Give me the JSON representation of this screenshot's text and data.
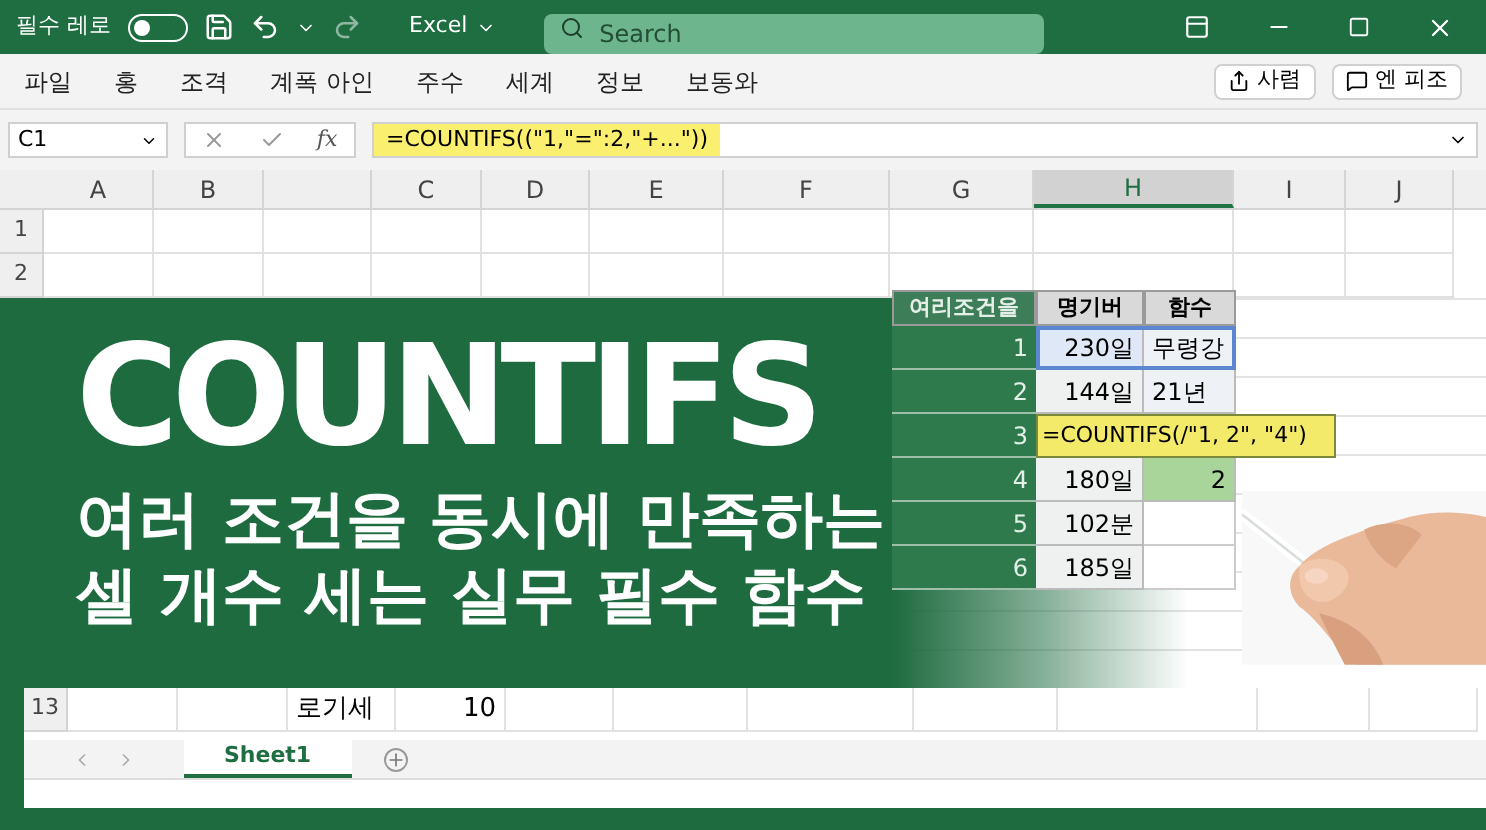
{
  "title_bar": {
    "autosave_label": "필수 레로",
    "autosave_on": false,
    "app_name": "Excel",
    "search": {
      "placeholder": "Search"
    }
  },
  "ribbon": {
    "tabs": [
      "파일",
      "홍",
      "조격",
      "계폭 아인",
      "주수",
      "세계",
      "정보",
      "보동와"
    ],
    "buttons": [
      {
        "kind": "share",
        "label": "사렴"
      },
      {
        "kind": "comment",
        "label": "엔 피조"
      }
    ]
  },
  "formula_bar": {
    "name_box": "C1",
    "function_label": "fx",
    "formula": "=COUNTIFS((\"1,\"=\":2,\"+...\"))"
  },
  "columns": [
    {
      "label": "A",
      "selected": false
    },
    {
      "label": "B",
      "selected": false
    },
    {
      "selected": false
    },
    {
      "label": "C",
      "selected": false
    },
    {
      "label": "D",
      "selected": false
    },
    {
      "label": "E",
      "selected": false
    },
    {
      "label": "F",
      "selected": false
    },
    {
      "label": "G",
      "selected": false
    },
    {
      "label": "H",
      "selected": true
    },
    {
      "label": "I",
      "selected": false
    },
    {
      "label": "J",
      "selected": false
    }
  ],
  "top_rows": [
    "1",
    "2"
  ],
  "banner": {
    "title": "COUNTIFS",
    "subtitle_lines": [
      "여러 조건을 동시에 만족하는",
      "셀 개수 세는 실무 필수 함수"
    ]
  },
  "table": {
    "header": [
      "여리조건을",
      "명기버",
      "함수"
    ],
    "rows": [
      {
        "kind": "data",
        "num": "1",
        "value": "230일",
        "result": "무령강",
        "selected": true
      },
      {
        "kind": "data",
        "num": "2",
        "value": "144일",
        "result": "21년",
        "selected": false
      },
      {
        "kind": "formula",
        "num": "3",
        "formula": "=COUNTIFS(/\"1, 2\", \"4\")",
        "selected": false
      },
      {
        "kind": "data",
        "num": "4",
        "value": "180일",
        "result": "2",
        "selected": false,
        "highlight": true
      },
      {
        "kind": "data",
        "num": "5",
        "value": "102분",
        "selected": false
      },
      {
        "kind": "data",
        "num": "6",
        "value": "185일",
        "selected": false
      }
    ]
  },
  "bottom_rows": [
    {
      "num": "13",
      "cells": [
        null,
        null,
        "로기세",
        "10"
      ]
    }
  ],
  "sheet_tabs": [
    {
      "label": "Sheet1",
      "selected": true
    }
  ]
}
